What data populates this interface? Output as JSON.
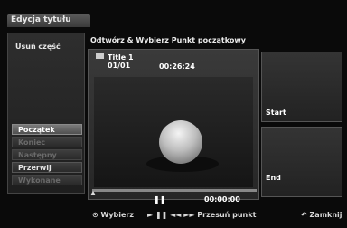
{
  "window": {
    "title": "Edycja tytułu"
  },
  "left_panel": {
    "section_title": "Usuń część",
    "buttons": [
      {
        "label": "Początek",
        "state": "active"
      },
      {
        "label": "Koniec",
        "state": "disabled"
      },
      {
        "label": "Następny",
        "state": "disabled"
      },
      {
        "label": "Przerwij",
        "state": "normal"
      },
      {
        "label": "Wykonane",
        "state": "disabled"
      }
    ]
  },
  "main": {
    "header": "Odtwórz & Wybierz Punkt początkowy",
    "title_name": "Title 1",
    "title_index": "01/01",
    "title_time": "00:26:24",
    "pause_symbol": "❚❚",
    "current_time": "00:00:00",
    "progress": 0
  },
  "marks": {
    "start_label": "Start",
    "end_label": "End"
  },
  "help_bar": {
    "select": "⊙ Wybierz",
    "controls": "► ❚❚ ◄◄ ►► Przesuń punkt",
    "close": "↶ Zamknij"
  }
}
